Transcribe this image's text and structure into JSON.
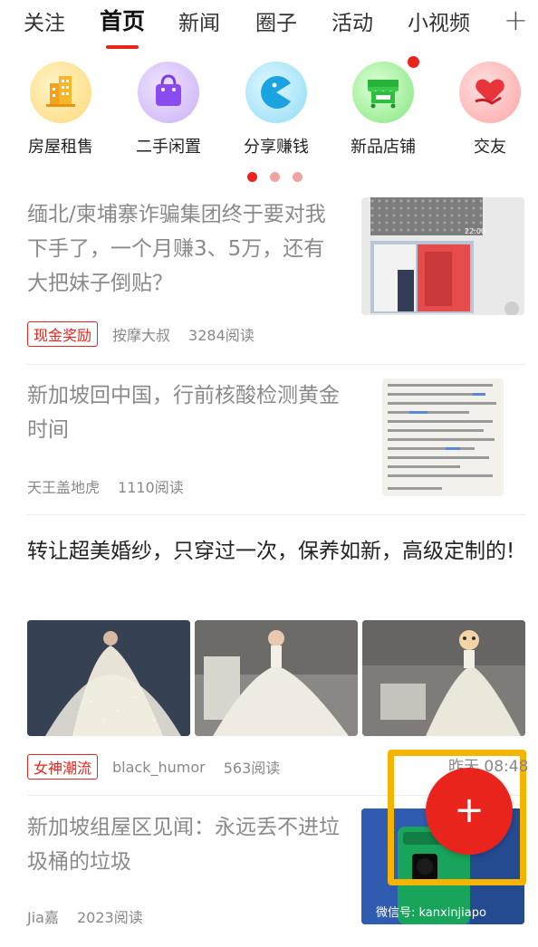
{
  "tabs": [
    {
      "label": "关注"
    },
    {
      "label": "首页"
    },
    {
      "label": "新闻"
    },
    {
      "label": "圈子"
    },
    {
      "label": "活动"
    },
    {
      "label": "小视频"
    }
  ],
  "tabs_active": "首页",
  "add_tab_symbol": "+",
  "quick_entries": [
    {
      "label": "房屋租售",
      "icon": "building-icon"
    },
    {
      "label": "二手闲置",
      "icon": "shopping-bag-icon"
    },
    {
      "label": "分享赚钱",
      "icon": "pacman-icon"
    },
    {
      "label": "新品店铺",
      "icon": "shop-stall-icon",
      "badge": true
    },
    {
      "label": "交友",
      "icon": "heart-hand-icon"
    }
  ],
  "pager": {
    "count": 3,
    "active": 0
  },
  "feed": [
    {
      "title": "缅北/柬埔寨诈骗集团终于要对我下手了，一个月赚3、5万，还有大把妹子倒贴？",
      "tag": "现金奖励",
      "source": "按摩大叔",
      "reads": "3284阅读",
      "thumb_time": "22:00"
    },
    {
      "title": "新加坡回中国，行前核酸检测黄金时间",
      "source": "天王盖地虎",
      "reads": "1110阅读"
    },
    {
      "title": "转让超美婚纱，只穿过一次，保养如新，高级定制的!",
      "tag": "女神潮流",
      "source": "black_humor",
      "reads": "563阅读",
      "time": "昨天 08:48"
    },
    {
      "title": "新加坡组屋区见闻：永远丢不进垃圾桶的垃圾",
      "source": "Jia嘉",
      "reads": "2023阅读",
      "watermark": "微信号: kanxinjiapo"
    }
  ],
  "fab_symbol": "+",
  "colors": {
    "accent": "#e8241d",
    "highlight": "#f5b400"
  }
}
